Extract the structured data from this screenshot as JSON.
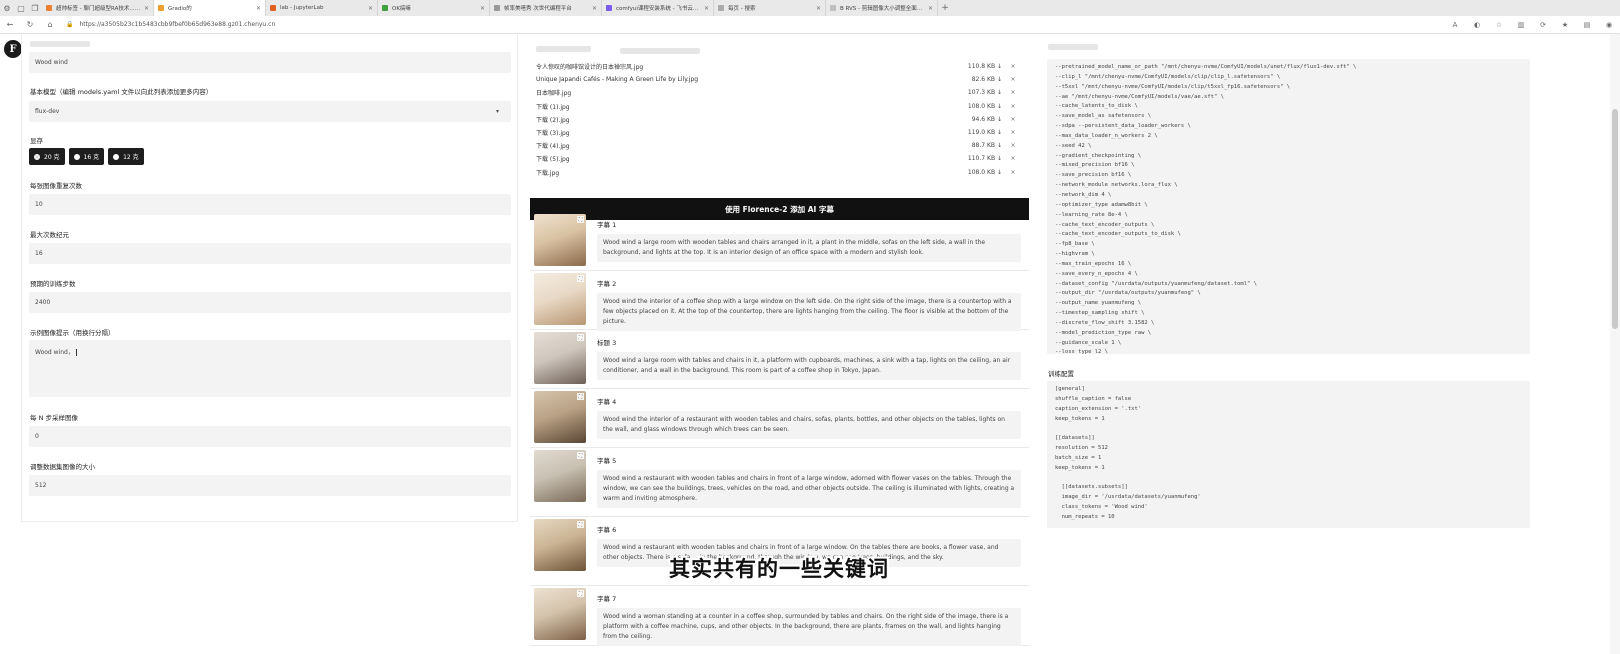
{
  "browser": {
    "tabs": [
      {
        "title": "超帅标签 - 聊门超级型RA技术... 后",
        "color": "#f08030",
        "active": false
      },
      {
        "title": "Gradio的",
        "color": "#f0a030",
        "active": true
      },
      {
        "title": "lab - JupyterLab",
        "color": "#e06020",
        "active": false
      },
      {
        "title": "OK搞嘛",
        "color": "#40a040",
        "active": false
      },
      {
        "title": "帧率美嗒秀 次世代编程平台",
        "color": "#999999",
        "active": false
      },
      {
        "title": "comfyui课程安装系统 - 飞书云文档",
        "color": "#7a5cf0",
        "active": false
      },
      {
        "title": "每页 - 搜索",
        "color": "#aaaaaa",
        "active": false
      },
      {
        "title": "B RVS - 剪辑图像大小调整全面指南",
        "color": "#c0c0c0",
        "active": false
      }
    ],
    "url": "https://a3505b23c1b5483cbb9fbef0b65d963e88.gz01.chenyu.cn"
  },
  "logo": "F",
  "left": {
    "trigger_word_value": "Wood wind",
    "base_model_label": "基本模型（编辑 models.yaml 文件以向此列表添加更多内容）",
    "base_model_value": "flux-dev",
    "vram_label": "显存",
    "vram_options": [
      {
        "label": "20 克",
        "selected": true
      },
      {
        "label": "16 克",
        "selected": false
      },
      {
        "label": "12 克",
        "selected": false
      }
    ],
    "repeat_label": "每张图像重复次数",
    "repeat_value": "10",
    "epochs_label": "最大次数纪元",
    "epochs_value": "16",
    "steps_label": "预期的训练步数",
    "steps_value": "2400",
    "sample_prompt_label": "示例图像提示（用换行分隔）",
    "sample_prompt_value": "Wood wind，",
    "sample_every_label": "每 N 步采样图像",
    "sample_every_value": "0",
    "resize_label": "调整数据集图像的大小",
    "resize_value": "512"
  },
  "middle": {
    "files": [
      {
        "name": "令人惊叹的咖啡馆设计的日本禅宗风.jpg",
        "size": "110.8 KB ↓"
      },
      {
        "name": "Unique Japandi Cafés - Making A Green Life by Lily.jpg",
        "size": "82.6 KB ↓"
      },
      {
        "name": "日本咖啡.jpg",
        "size": "107.3 KB ↓"
      },
      {
        "name": "下载 (1).jpg",
        "size": "108.0 KB ↓"
      },
      {
        "name": "下载 (2).jpg",
        "size": "94.6 KB ↓"
      },
      {
        "name": "下载 (3).jpg",
        "size": "119.0 KB ↓"
      },
      {
        "name": "下载 (4).jpg",
        "size": "88.7 KB ↓"
      },
      {
        "name": "下载 (5).jpg",
        "size": "110.7 KB ↓"
      },
      {
        "name": "下载.jpg",
        "size": "108.0 KB ↓"
      }
    ],
    "banner": "使用 Florence-2 添加 AI 字幕",
    "captions": [
      {
        "label": "字幕 1",
        "text": "Wood wind a large room with wooden tables and chairs arranged in it, a plant in the middle, sofas on the left side, a wall in the background, and lights at the top. It is an interior design of an office space with a modern and stylish look."
      },
      {
        "label": "字幕 2",
        "text": "Wood wind the interior of a coffee shop with a large window on the left side. On the right side of the image, there is a countertop with a few objects placed on it. At the top of the countertop, there are lights hanging from the ceiling. The floor is visible at the bottom of the picture."
      },
      {
        "label": "标题 3",
        "text": "Wood wind a large room with tables and chairs in it, a platform with cupboards, machines, a sink with a tap, lights on the ceiling, an air conditioner, and a wall in the background. This room is part of a coffee shop in Tokyo, Japan."
      },
      {
        "label": "字幕 4",
        "text": "Wood wind the interior of a restaurant with wooden tables and chairs, sofas, plants, bottles, and other objects on the tables, lights on the wall, and glass windows through which trees can be seen."
      },
      {
        "label": "字幕 5",
        "text": "Wood wind a restaurant with wooden tables and chairs in front of a large window, adorned with flower vases on the tables. Through the window, we can see the buildings, trees, vehicles on the road, and other objects outside. The ceiling is illuminated with lights, creating a warm and inviting atmosphere."
      },
      {
        "label": "字幕 6",
        "text": "Wood wind a restaurant with wooden tables and chairs in front of a large window. On the tables there are books, a flower vase, and other objects. There is a sofa ... in the background, through the window, we can see trees, buildings, and the sky."
      },
      {
        "label": "字幕 7",
        "text": "Wood wind a woman standing at a counter in a coffee shop, surrounded by tables and chairs. On the right side of the image, there is a platform with a coffee machine, cups, and other objects. In the background, there are plants, frames on the wall, and lights hanging from the ceiling."
      }
    ]
  },
  "right": {
    "script_lines": [
      "--pretrained_model_name_or_path \"/mnt/chenyu-nvme/ComfyUI/models/unet/flux/flux1-dev.sft\" \\",
      "--clip_l \"/mnt/chenyu-nvme/ComfyUI/models/clip/clip_l.safetensors\" \\",
      "--t5xxl \"/mnt/chenyu-nvme/ComfyUI/models/clip/t5xxl_fp16.safetensors\" \\",
      "--ae \"/mnt/chenyu-nvme/ComfyUI/models/vae/ae.sft\" \\",
      "--cache_latents_to_disk \\",
      "--save_model_as safetensors \\",
      "--sdpa --persistent_data_loader_workers \\",
      "--max_data_loader_n_workers 2 \\",
      "--seed 42 \\",
      "--gradient_checkpointing \\",
      "--mixed_precision bf16 \\",
      "--save_precision bf16 \\",
      "--network_module networks.lora_flux \\",
      "--network_dim 4 \\",
      "--optimizer_type adamw8bit \\",
      "--learning_rate 8e-4 \\",
      "--cache_text_encoder_outputs \\",
      "--cache_text_encoder_outputs_to_disk \\",
      "--fp8_base \\",
      "--highvram \\",
      "--max_train_epochs 16 \\",
      "--save_every_n_epochs 4 \\",
      "--dataset_config \"/usrdata/outputs/yuanmufeng/dataset.toml\" \\",
      "--output_dir \"/usrdata/outputs/yuanmufeng\" \\",
      "--output_name yuanmufeng \\",
      "--timestep_sampling shift \\",
      "--discrete_flow_shift 3.1582 \\",
      "--model_prediction_type raw \\",
      "--guidance_scale 1 \\",
      "--loss_type l2 \\"
    ],
    "config_label": "训练配置",
    "config_lines": [
      "[general]",
      "shuffle_caption = false",
      "caption_extension = '.txt'",
      "keep_tokens = 1",
      "",
      "[[datasets]]",
      "resolution = 512",
      "batch_size = 1",
      "keep_tokens = 1",
      "",
      "  [[datasets.subsets]]",
      "  image_dir = '/usrdata/datasets/yuanmufeng'",
      "  class_tokens = 'Wood wind'",
      "  num_repeats = 10"
    ]
  },
  "subtitle": "其实共有的一些关键词"
}
